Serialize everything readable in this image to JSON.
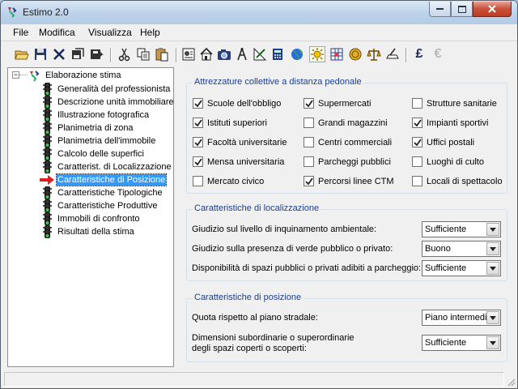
{
  "window": {
    "title": "Estimo 2.0"
  },
  "menu": [
    "File",
    "Modifica",
    "Visualizza",
    "Help"
  ],
  "toolbar": {
    "icons": [
      "open-folder-icon",
      "save-icon",
      "delete-icon",
      "save-as-icon",
      "export-icon",
      "cut-icon",
      "copy-icon",
      "paste-icon",
      "report-icon",
      "house-icon",
      "camera-icon",
      "compass-icon",
      "drawing-icon",
      "calculator-icon",
      "globe-icon",
      "sun-icon",
      "grid-icon",
      "coins-icon",
      "scales-icon",
      "deed-icon",
      "pound-icon",
      "euro-icon"
    ],
    "pound_label": "£",
    "euro_label": "€"
  },
  "tree": {
    "root": "Elaborazione stima",
    "root_expander": "−",
    "items": [
      "Generalità del professionista",
      "Descrizione unità immobiliare",
      "Illustrazione fotografica",
      "Planimetria di zona",
      "Planimetria dell'immobile",
      "Calcolo delle superfici",
      "Caratterist. di Localizzazione",
      "Caratteristiche di Posizione",
      "Caratteristiche Tipologiche",
      "Caratteristiche Produttive",
      "Immobili di confronto",
      "Risultati della stima"
    ],
    "selected_index": 7
  },
  "attrezzature": {
    "legend": "Attrezzature collettive a distanza pedonale",
    "items": [
      {
        "label": "Scuole dell'obbligo",
        "checked": true
      },
      {
        "label": "Supermercati",
        "checked": true
      },
      {
        "label": "Strutture sanitarie",
        "checked": false
      },
      {
        "label": "Istituti superiori",
        "checked": true
      },
      {
        "label": "Grandi magazzini",
        "checked": false
      },
      {
        "label": "Impianti sportivi",
        "checked": true
      },
      {
        "label": "Facoltà universitarie",
        "checked": true
      },
      {
        "label": "Centri commerciali",
        "checked": false
      },
      {
        "label": "Uffici postali",
        "checked": true
      },
      {
        "label": "Mensa universitaria",
        "checked": true
      },
      {
        "label": "Parcheggi pubblici",
        "checked": false
      },
      {
        "label": "Luoghi di culto",
        "checked": false
      },
      {
        "label": "Mercato civico",
        "checked": false
      },
      {
        "label": "Percorsi linee CTM",
        "checked": true
      },
      {
        "label": "Locali di spettacolo",
        "checked": false
      }
    ]
  },
  "localizzazione": {
    "legend": "Caratteristiche di localizzazione",
    "rows": [
      {
        "label": "Giudizio sul livello di inquinamento ambientale:",
        "value": "Sufficiente"
      },
      {
        "label": "Giudizio sulla presenza di verde pubblico o privato:",
        "value": "Buono"
      },
      {
        "label": "Disponibilità di spazi pubblici o privati adibiti a parcheggio:",
        "value": "Sufficiente"
      }
    ]
  },
  "posizione": {
    "legend": "Caratteristiche di posizione",
    "rows": [
      {
        "label": "Quota rispetto al piano stradale:",
        "label2": "",
        "value": "Piano intermedio"
      },
      {
        "label": "Dimensioni subordinarie o superordinarie",
        "label2": "degli spazi coperti o scoperti:",
        "value": "Sufficiente"
      }
    ]
  },
  "colors": {
    "legend": "#1b3e8f",
    "selection": "#3399ff"
  }
}
